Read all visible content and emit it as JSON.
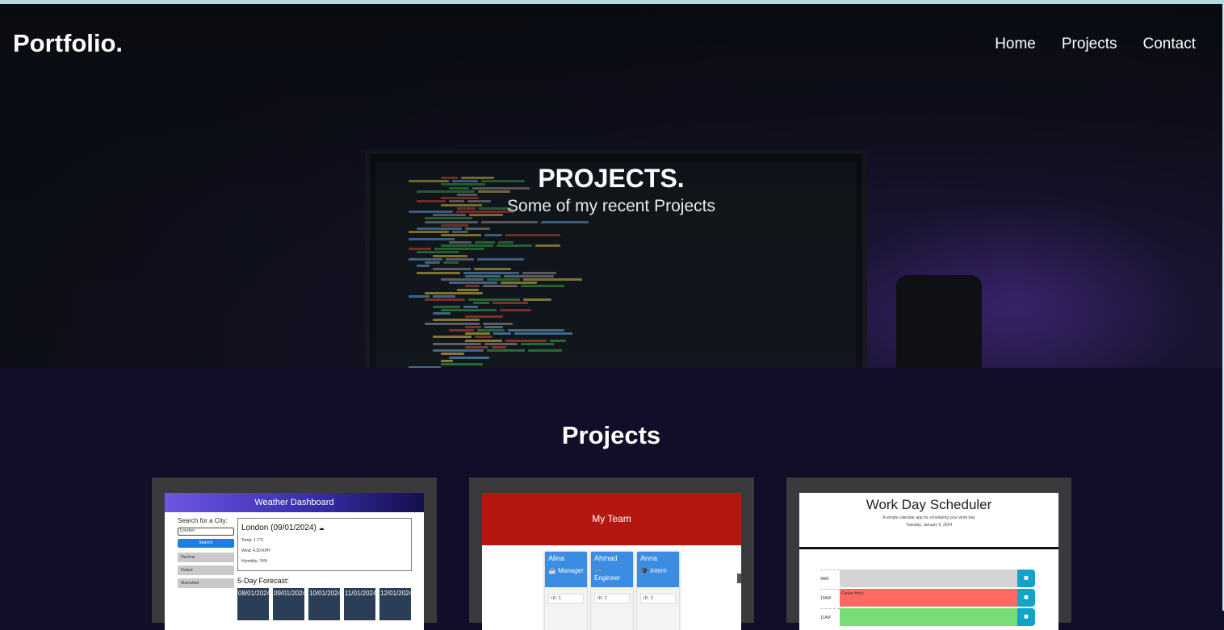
{
  "nav": {
    "brand": "Portfolio.",
    "links": [
      "Home",
      "Projects",
      "Contact"
    ]
  },
  "hero": {
    "title": "PROJECTS.",
    "subtitle": "Some of my recent Projects"
  },
  "projects_section": {
    "title": "Projects"
  },
  "cards": {
    "weather": {
      "title": "Weather Dashboard",
      "search_label": "Search for a City:",
      "search_value": "London",
      "search_button": "Search",
      "history": [
        "Harlow",
        "Dubai",
        "Stansted"
      ],
      "current_city": "London (09/01/2024)",
      "current_icon": "☁",
      "temp": "Temp: 1.7°C",
      "wind": "Wind: 4.20 KPH",
      "humidity": "Humidity: 74%",
      "forecast_title": "5-Day Forecast:",
      "forecast_days": [
        "08/01/2024",
        "09/01/2024",
        "10/01/2024",
        "11/01/2024",
        "12/01/2024"
      ]
    },
    "team": {
      "title": "My Team",
      "members": [
        {
          "name": "Alina",
          "role": "Manager",
          "role_icon": "☕",
          "field": "ID: 1"
        },
        {
          "name": "Ahmad",
          "role": "Engineer",
          "role_icon": "👓",
          "field": "ID: 2"
        },
        {
          "name": "Anna",
          "role": "Intern",
          "role_icon": "🎓",
          "field": "ID: 3"
        }
      ]
    },
    "scheduler": {
      "title": "Work Day Scheduler",
      "subtitle": "A simple calendar app for scheduling your work day",
      "date": "Tuesday, January 9, 2024",
      "rows": [
        {
          "hour": "9AM",
          "text": "",
          "color": "#d3d3d3"
        },
        {
          "hour": "10AM",
          "text": "Career Hour",
          "color": "#ff6961"
        },
        {
          "hour": "11AM",
          "text": "",
          "color": "#77dd77"
        }
      ]
    }
  },
  "colors": {
    "page_bg": "#120d28",
    "card_bg": "#3a3a3d",
    "weather_header": "#4b3bc9",
    "team_header": "#b3170f",
    "team_member_header": "#3a8de0",
    "scheduler_save": "#14a3c8",
    "top_strip": "#b6dadf"
  }
}
